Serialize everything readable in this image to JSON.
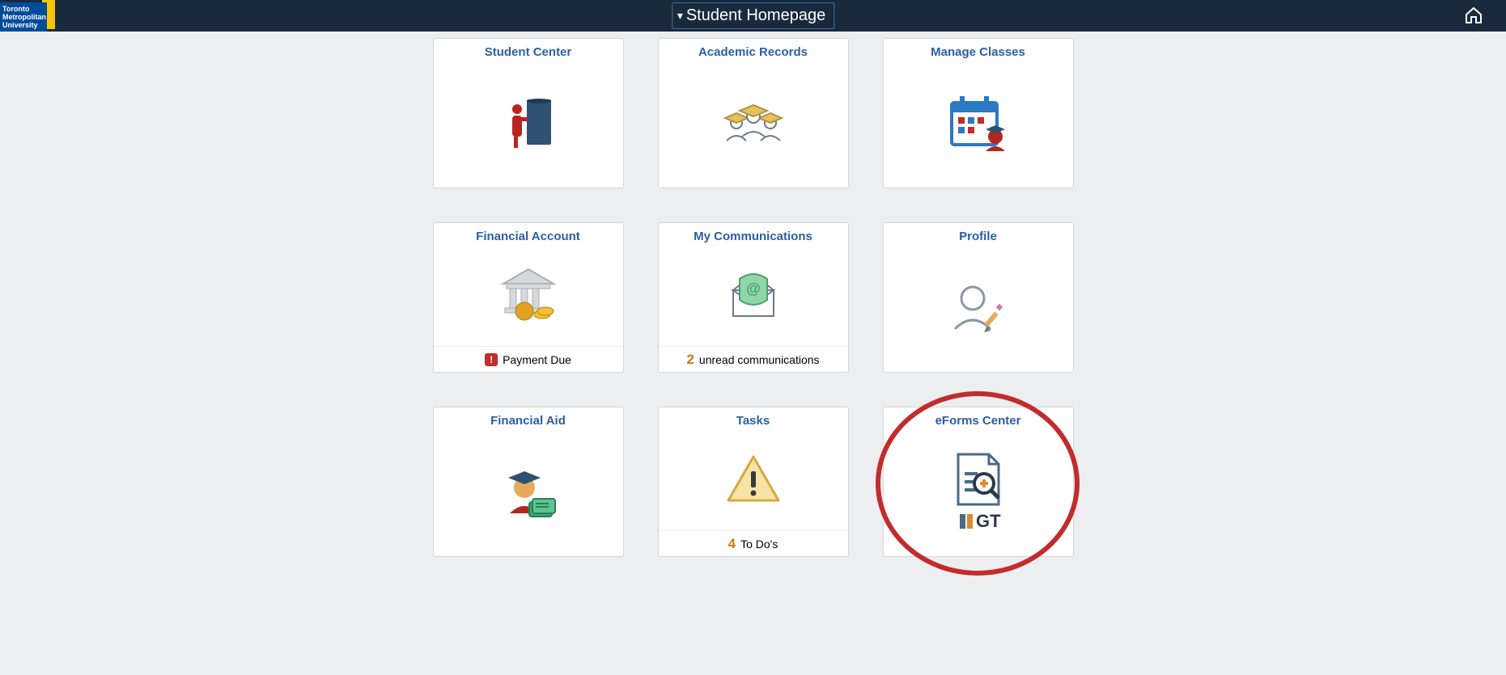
{
  "header": {
    "logo_line1": "Toronto",
    "logo_line2": "Metropolitan",
    "logo_line3": "University",
    "page_title": "Student Homepage"
  },
  "tiles": [
    {
      "title": "Student Center",
      "status_count": "",
      "status_text": ""
    },
    {
      "title": "Academic Records",
      "status_count": "",
      "status_text": ""
    },
    {
      "title": "Manage Classes",
      "status_count": "",
      "status_text": ""
    },
    {
      "title": "Financial Account",
      "status_count": "",
      "status_text": "Payment Due",
      "status_alert": true
    },
    {
      "title": "My Communications",
      "status_count": "2",
      "status_text": "unread communications"
    },
    {
      "title": "Profile",
      "status_count": "",
      "status_text": ""
    },
    {
      "title": "Financial Aid",
      "status_count": "",
      "status_text": ""
    },
    {
      "title": "Tasks",
      "status_count": "4",
      "status_text": "To Do's"
    },
    {
      "title": "eForms Center",
      "status_count": "",
      "status_text": "",
      "highlighted": true
    }
  ]
}
